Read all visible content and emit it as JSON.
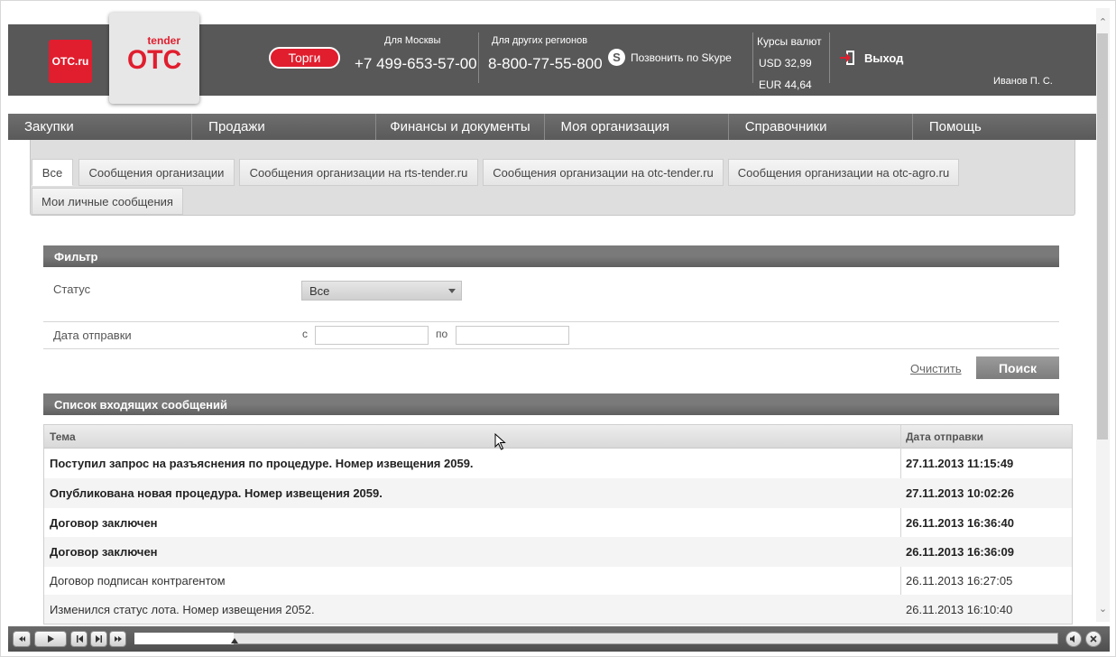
{
  "header": {
    "logo_small": "OTC.ru",
    "logo_tender": "tender",
    "logo_main": "OTC",
    "torgi_label": "Торги",
    "moscow_label": "Для Москвы",
    "moscow_phone": "+7 499-653-57-00",
    "regions_label": "Для других регионов",
    "regions_phone": "8-800-77-55-800",
    "skype_label": "Позвонить по Skype",
    "rates_label": "Курсы валют",
    "usd_rate": "USD 32,99",
    "eur_rate": "EUR 44,64",
    "exit_label": "Выход",
    "user_name": "Иванов П. С."
  },
  "nav": {
    "items": [
      "Закупки",
      "Продажи",
      "Финансы и документы",
      "Моя организация",
      "Справочники",
      "Помощь"
    ]
  },
  "tabs": {
    "items": [
      "Все",
      "Сообщения организации",
      "Сообщения организации на rts-tender.ru",
      "Сообщения организации на otc-tender.ru",
      "Сообщения организации на otc-agro.ru",
      "Мои личные сообщения"
    ]
  },
  "filter": {
    "title": "Фильтр",
    "status_label": "Статус",
    "status_value": "Все",
    "date_label": "Дата отправки",
    "from_label": "с",
    "to_label": "по",
    "clear_label": "Очистить",
    "search_label": "Поиск"
  },
  "messages": {
    "title": "Список входящих сообщений",
    "col_subject": "Тема",
    "col_date": "Дата отправки",
    "rows": [
      {
        "subject": "Поступил запрос на разъяснения по процедуре. Номер извещения 2059.",
        "date": "27.11.2013 11:15:49",
        "unread": true
      },
      {
        "subject": "Опубликована новая процедура. Номер извещения 2059.",
        "date": "27.11.2013 10:02:26",
        "unread": true
      },
      {
        "subject": "Договор заключен",
        "date": "26.11.2013 16:36:40",
        "unread": true
      },
      {
        "subject": "Договор заключен",
        "date": "26.11.2013 16:36:09",
        "unread": true
      },
      {
        "subject": "Договор подписан контрагентом",
        "date": "26.11.2013 16:27:05",
        "unread": false
      },
      {
        "subject": "Изменился статус лота. Номер извещения 2052.",
        "date": "26.11.2013 16:10:40",
        "unread": false
      }
    ]
  },
  "colors": {
    "brand_red": "#e01e2e",
    "header_bg": "#585858"
  }
}
